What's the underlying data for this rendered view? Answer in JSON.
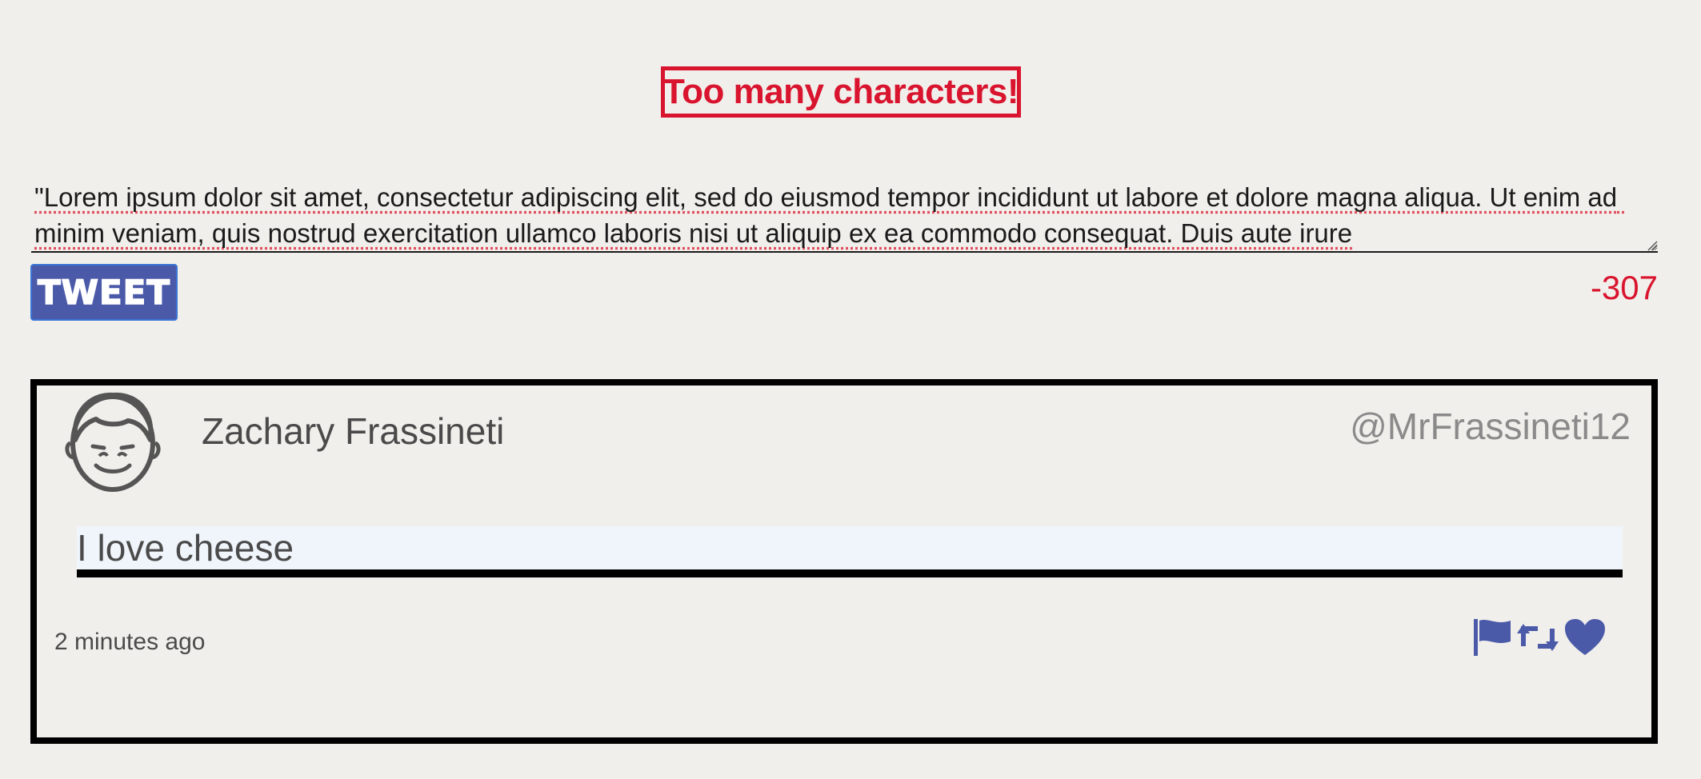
{
  "error": {
    "message": "Too many characters!"
  },
  "compose": {
    "value": "\"Lorem ipsum dolor sit amet, consectetur adipiscing elit, sed do eiusmod tempor incididunt ut labore et dolore magna aliqua. Ut enim ad minim veniam, quis nostrud exercitation ullamco laboris nisi ut aliquip ex ea commodo consequat. Duis aute irure"
  },
  "toolbar": {
    "tweet_label": "TWEET",
    "char_count": "-307"
  },
  "tweet": {
    "author_name": "Zachary Frassineti",
    "author_handle": "@MrFrassineti12",
    "body": "I love cheese",
    "timestamp": "2 minutes ago"
  },
  "icons": {
    "avatar": "face-avatar-icon",
    "flag": "flag-icon",
    "retweet": "retweet-icon",
    "like": "heart-icon"
  },
  "colors": {
    "background": "#f1efeb",
    "error": "#d9142e",
    "accent": "#4b5aa8",
    "card_border": "#000000"
  }
}
